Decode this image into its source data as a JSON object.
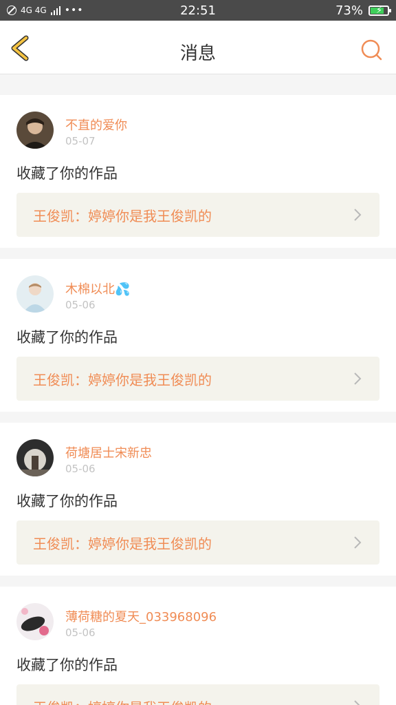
{
  "status_bar": {
    "network": "4G 4G",
    "time": "22:51",
    "battery": "73%",
    "battery_level": 0.73
  },
  "header": {
    "title": "消息",
    "back_icon": "chevron-left-icon",
    "search_icon": "search-icon"
  },
  "colors": {
    "accent": "#f08c55",
    "back_icon": "#f5c342",
    "card_link_bg": "#f4f3ec"
  },
  "messages": [
    {
      "user": "不直的爱你",
      "date": "05-07",
      "action": "收藏了你的作品",
      "work": "王俊凯：婷婷你是我王俊凯的"
    },
    {
      "user": "木棉以北💦",
      "date": "05-06",
      "action": "收藏了你的作品",
      "work": "王俊凯：婷婷你是我王俊凯的"
    },
    {
      "user": "荷塘居士宋新忠",
      "date": "05-06",
      "action": "收藏了你的作品",
      "work": "王俊凯：婷婷你是我王俊凯的"
    },
    {
      "user": "薄荷糖的夏天_033968096",
      "date": "05-06",
      "action": "收藏了你的作品",
      "work": "王俊凯：婷婷你是我王俊凯的"
    }
  ]
}
